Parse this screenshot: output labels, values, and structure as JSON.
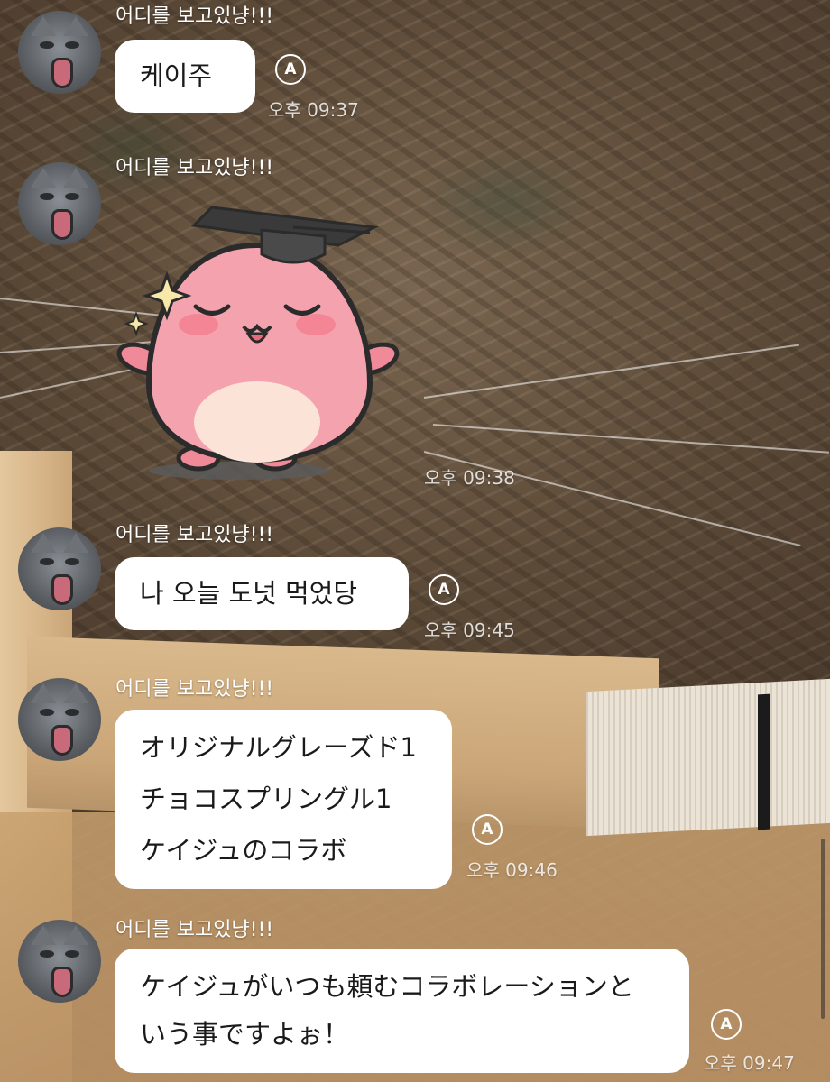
{
  "sender_name": "어디를 보고있냥!!!",
  "messages": [
    {
      "type": "text",
      "lines": [
        "케이주"
      ],
      "time": "오후 09:37"
    },
    {
      "type": "sticker",
      "sticker": "pink-graduate-character-sticker",
      "time": "오후 09:38"
    },
    {
      "type": "text",
      "lines": [
        "나 오늘 도넛 먹었당"
      ],
      "time": "오후 09:45"
    },
    {
      "type": "text",
      "lines": [
        "オリジナルグレーズド1",
        "チョコスプリングル1",
        "ケイジュのコラボ"
      ],
      "time": "오후 09:46"
    },
    {
      "type": "text",
      "lines": [
        "ケイジュがいつも頼むコラボレーションと",
        "いう事ですよぉ！"
      ],
      "time": "오후 09:47"
    }
  ],
  "translate_icon_label": "A",
  "colors": {
    "bubble": "#ffffff",
    "text": "#1a1a1a",
    "meta_text": "#ffffff"
  }
}
